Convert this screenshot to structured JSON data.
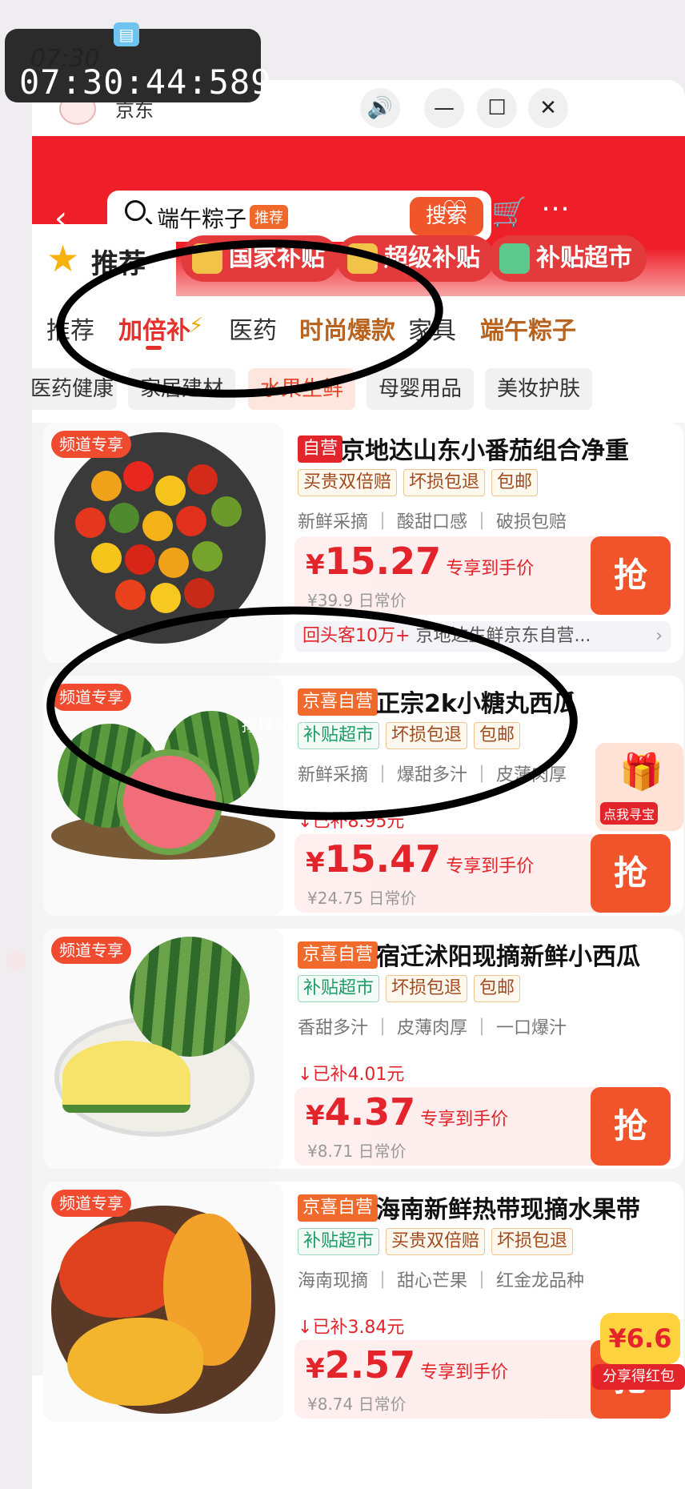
{
  "overlay": {
    "clock_small": "07:30",
    "clock": "07:30:44:589"
  },
  "window": {
    "app_name": "京东"
  },
  "header": {
    "search_query": "端午粽子",
    "search_tag": "推荐",
    "search_button": "搜索"
  },
  "channels": {
    "active": "推荐",
    "chips": [
      "国家补贴",
      "超级补贴",
      "补贴超市"
    ]
  },
  "tabs": [
    "推荐",
    "加倍补",
    "医药",
    "时尚爆款",
    "家具",
    "端午粽子"
  ],
  "subcategories": [
    "医药健康",
    "家居建材",
    "水果生鲜",
    "母婴用品",
    "美妆护肤"
  ],
  "products": [
    {
      "tag": "频道专享",
      "badge": "自营",
      "title": "京地达山东小番茄组合净重",
      "tags": [
        "买贵双倍赔",
        "坏损包退",
        "包邮"
      ],
      "features": "新鲜采摘 ｜ 酸甜口感 ｜ 破损包赔",
      "saved": "",
      "currency": "¥",
      "price": "15.27",
      "price_label": "专享到手价",
      "orig": "¥39.9 日常价",
      "shop": "回头客10万+",
      "shop_name": "京地达生鲜京东自营...",
      "grab": "抢"
    },
    {
      "tag": "频道专享",
      "badge": "京喜自营",
      "title": "正宗2k小糖丸西瓜",
      "tags": [
        "补贴超市",
        "坏损包退",
        "包邮"
      ],
      "features": "新鲜采摘 ｜ 爆甜多汁 ｜ 皮薄肉厚",
      "saved": "已补8.95元",
      "currency": "¥",
      "price": "15.47",
      "price_label": "专享到手价",
      "orig": "¥24.75 日常价",
      "grab": "抢"
    },
    {
      "tag": "频道专享",
      "badge": "京喜自营",
      "title": "宿迁沭阳现摘新鲜小西瓜",
      "tags": [
        "补贴超市",
        "坏损包退",
        "包邮"
      ],
      "features": "香甜多汁 ｜ 皮薄肉厚 ｜ 一口爆汁",
      "saved": "已补4.01元",
      "currency": "¥",
      "price": "4.37",
      "price_label": "专享到手价",
      "orig": "¥8.71 日常价",
      "grab": "抢"
    },
    {
      "tag": "频道专享",
      "badge": "京喜自营",
      "title": "海南新鲜热带现摘水果带",
      "tags": [
        "补贴超市",
        "买贵双倍赔",
        "坏损包退"
      ],
      "features": "海南现摘 ｜ 甜心芒果 ｜ 红金龙品种",
      "saved": "已补3.84元",
      "currency": "¥",
      "price": "2.57",
      "price_label": "专享到手价",
      "orig": "¥8.74 日常价",
      "grab": "抢"
    }
  ],
  "floating": {
    "treasure_label": "点我寻宝",
    "redpacket_amount": "¥6.6",
    "redpacket_label": "分享得红包"
  },
  "watermark": "撑撑糖力"
}
